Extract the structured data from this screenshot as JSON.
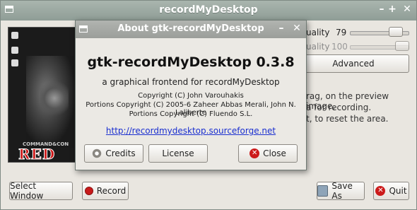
{
  "main_window": {
    "title": "recordMyDesktop",
    "controls": {
      "minimize": "–",
      "maximize": "+",
      "close": "✕"
    },
    "quality_label": "uality",
    "video_quality": "79",
    "audio_quality_label": "uality",
    "audio_quality": "100",
    "advanced_label": "Advanced",
    "info_lines": [
      "rag, on the preview image,",
      "a for recording.",
      "t, to reset the area."
    ],
    "preview_brand": "COMMAND&CON",
    "preview_logo": "RED AL",
    "select_window_label": "Select Window",
    "record_label": "Record",
    "save_as_label": "Save As",
    "quit_label": "Quit",
    "video_slider_fraction": 0.86,
    "audio_slider_fraction": 1.0
  },
  "about_dialog": {
    "title": "About gtk-recordMyDesktop",
    "close_x": "✕",
    "minimize": "–",
    "app_name": "gtk-recordMyDesktop 0.3.8",
    "tagline": "a graphical frontend for recordMyDesktop",
    "copyright_lines": [
      "Copyright (C) John Varouhakis",
      "Portions Copyright (C) 2005-6 Zaheer Abbas Merali, John N. Laliberte",
      "Portions Copyright (C) Fluendo S.L."
    ],
    "website": "http://recordmydesktop.sourceforge.net",
    "credits_label": "Credits",
    "license_label": "License",
    "close_label": "Close"
  },
  "colors": {
    "close_red": "#cc1b1b",
    "link_blue": "#1a2fd0"
  }
}
